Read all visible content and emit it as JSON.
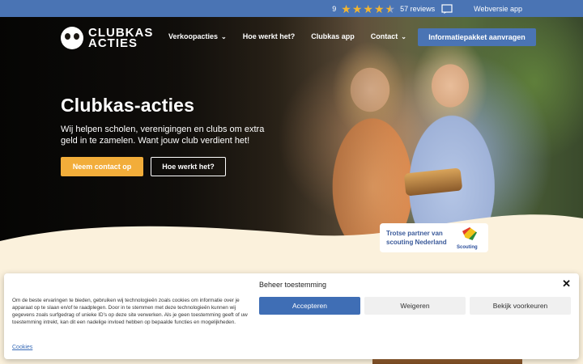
{
  "topbar": {
    "rating": "9",
    "stars": "★",
    "reviews": "57 reviews",
    "webapp": "Webversie app"
  },
  "logo": {
    "line1": "CLUBKAS",
    "line2": "ACTIES"
  },
  "nav": {
    "items": [
      "Verkoopacties",
      "Hoe werkt het?",
      "Clubkas app",
      "Contact"
    ],
    "chevron": "⌄",
    "cta": "Informatiepakket aanvragen"
  },
  "hero": {
    "title": "Clubkas-acties",
    "subtitle": "Wij helpen scholen, verenigingen en clubs om extra geld in te zamelen. Want jouw club verdient het!",
    "primary_button": "Neem contact op",
    "secondary_button": "Hoe werkt het?"
  },
  "partner": {
    "text": "Trotse partner van scouting Nederland",
    "logo_label": "Scouting"
  },
  "cookie": {
    "title": "Beheer toestemming",
    "close": "✕",
    "text": "Om de beste ervaringen te bieden, gebruiken wij technologieën zoals cookies om informatie over je apparaat op te slaan en/of te raadplegen. Door in te stemmen met deze technologieën kunnen wij gegevens zoals surfgedrag of unieke ID's op deze site verwerken. Als je geen toestemming geeft of uw toestemming intrekt, kan dit een nadelige invloed hebben op bepaalde functies en mogelijkheden.",
    "link": "Cookies",
    "accept": "Accepteren",
    "deny": "Weigeren",
    "preferences": "Bekijk voorkeuren"
  },
  "colors": {
    "brand_blue": "#4a74b4",
    "accent_orange": "#f2ad3a",
    "cream": "#fbf1dc",
    "star": "#f2b531"
  }
}
